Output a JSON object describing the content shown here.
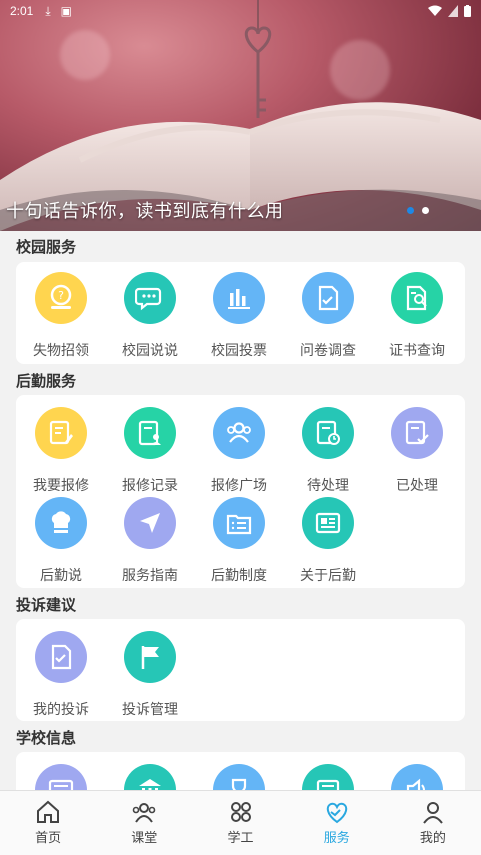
{
  "status_bar": {
    "time": "2:01"
  },
  "banner": {
    "caption": "十句话告诉你，读书到底有什么用",
    "slides": 2,
    "active_slide": 0
  },
  "sections": [
    {
      "title": "校园服务",
      "items": [
        {
          "label": "失物招领",
          "icon": "lost-found-icon",
          "color": "#ffd54f"
        },
        {
          "label": "校园说说",
          "icon": "chat-bubble-icon",
          "color": "#26c6b6"
        },
        {
          "label": "校园投票",
          "icon": "bar-chart-icon",
          "color": "#64b5f6"
        },
        {
          "label": "问卷调查",
          "icon": "survey-icon",
          "color": "#64b5f6"
        },
        {
          "label": "证书查询",
          "icon": "certificate-search-icon",
          "color": "#26d3a6"
        }
      ]
    },
    {
      "title": "后勤服务",
      "items": [
        {
          "label": "我要报修",
          "icon": "edit-form-icon",
          "color": "#ffd54f"
        },
        {
          "label": "报修记录",
          "icon": "record-user-icon",
          "color": "#26d3a6"
        },
        {
          "label": "报修广场",
          "icon": "group-icon",
          "color": "#64b5f6"
        },
        {
          "label": "待处理",
          "icon": "pending-clock-icon",
          "color": "#26c6b6"
        },
        {
          "label": "已处理",
          "icon": "done-check-icon",
          "color": "#9fa8f0"
        },
        {
          "label": "后勤说",
          "icon": "chef-hat-icon",
          "color": "#64b5f6"
        },
        {
          "label": "服务指南",
          "icon": "navigation-arrow-icon",
          "color": "#9fa8f0"
        },
        {
          "label": "后勤制度",
          "icon": "folder-list-icon",
          "color": "#64b5f6"
        },
        {
          "label": "关于后勤",
          "icon": "newspaper-icon",
          "color": "#26c6b6"
        }
      ]
    },
    {
      "title": "投诉建议",
      "items": [
        {
          "label": "我的投诉",
          "icon": "complaint-doc-icon",
          "color": "#9fa8f0"
        },
        {
          "label": "投诉管理",
          "icon": "flag-icon",
          "color": "#26c6b6"
        }
      ]
    },
    {
      "title": "学校信息",
      "items": [
        {
          "label": "",
          "icon": "newspaper-icon",
          "color": "#9fa8f0"
        },
        {
          "label": "",
          "icon": "building-icon",
          "color": "#26c6b6"
        },
        {
          "label": "",
          "icon": "trophy-icon",
          "color": "#64b5f6"
        },
        {
          "label": "",
          "icon": "notice-icon",
          "color": "#26c6b6"
        },
        {
          "label": "",
          "icon": "speaker-icon",
          "color": "#64b5f6"
        }
      ]
    }
  ],
  "bottom_nav": [
    {
      "label": "首页",
      "icon": "home-icon"
    },
    {
      "label": "课堂",
      "icon": "classroom-icon"
    },
    {
      "label": "学工",
      "icon": "grid-apps-icon"
    },
    {
      "label": "服务",
      "icon": "handshake-icon",
      "active": true
    },
    {
      "label": "我的",
      "icon": "user-icon"
    }
  ],
  "active_color": "#2aa8e0"
}
